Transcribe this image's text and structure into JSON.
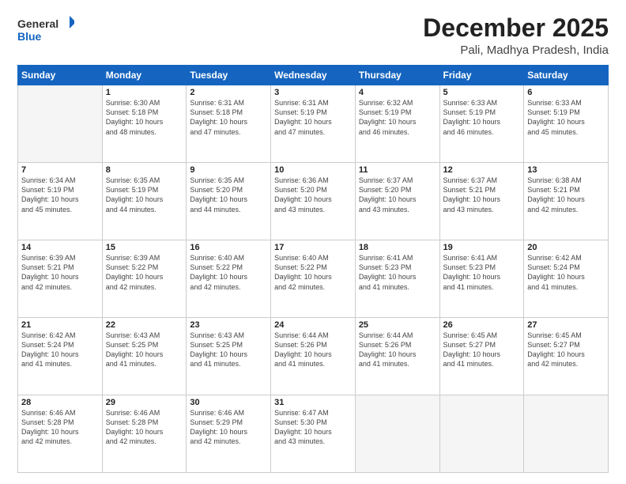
{
  "logo": {
    "line1": "General",
    "line2": "Blue"
  },
  "title": "December 2025",
  "subtitle": "Pali, Madhya Pradesh, India",
  "headers": [
    "Sunday",
    "Monday",
    "Tuesday",
    "Wednesday",
    "Thursday",
    "Friday",
    "Saturday"
  ],
  "weeks": [
    [
      {
        "day": "",
        "info": ""
      },
      {
        "day": "1",
        "info": "Sunrise: 6:30 AM\nSunset: 5:18 PM\nDaylight: 10 hours\nand 48 minutes."
      },
      {
        "day": "2",
        "info": "Sunrise: 6:31 AM\nSunset: 5:18 PM\nDaylight: 10 hours\nand 47 minutes."
      },
      {
        "day": "3",
        "info": "Sunrise: 6:31 AM\nSunset: 5:19 PM\nDaylight: 10 hours\nand 47 minutes."
      },
      {
        "day": "4",
        "info": "Sunrise: 6:32 AM\nSunset: 5:19 PM\nDaylight: 10 hours\nand 46 minutes."
      },
      {
        "day": "5",
        "info": "Sunrise: 6:33 AM\nSunset: 5:19 PM\nDaylight: 10 hours\nand 46 minutes."
      },
      {
        "day": "6",
        "info": "Sunrise: 6:33 AM\nSunset: 5:19 PM\nDaylight: 10 hours\nand 45 minutes."
      }
    ],
    [
      {
        "day": "7",
        "info": "Sunrise: 6:34 AM\nSunset: 5:19 PM\nDaylight: 10 hours\nand 45 minutes."
      },
      {
        "day": "8",
        "info": "Sunrise: 6:35 AM\nSunset: 5:19 PM\nDaylight: 10 hours\nand 44 minutes."
      },
      {
        "day": "9",
        "info": "Sunrise: 6:35 AM\nSunset: 5:20 PM\nDaylight: 10 hours\nand 44 minutes."
      },
      {
        "day": "10",
        "info": "Sunrise: 6:36 AM\nSunset: 5:20 PM\nDaylight: 10 hours\nand 43 minutes."
      },
      {
        "day": "11",
        "info": "Sunrise: 6:37 AM\nSunset: 5:20 PM\nDaylight: 10 hours\nand 43 minutes."
      },
      {
        "day": "12",
        "info": "Sunrise: 6:37 AM\nSunset: 5:21 PM\nDaylight: 10 hours\nand 43 minutes."
      },
      {
        "day": "13",
        "info": "Sunrise: 6:38 AM\nSunset: 5:21 PM\nDaylight: 10 hours\nand 42 minutes."
      }
    ],
    [
      {
        "day": "14",
        "info": "Sunrise: 6:39 AM\nSunset: 5:21 PM\nDaylight: 10 hours\nand 42 minutes."
      },
      {
        "day": "15",
        "info": "Sunrise: 6:39 AM\nSunset: 5:22 PM\nDaylight: 10 hours\nand 42 minutes."
      },
      {
        "day": "16",
        "info": "Sunrise: 6:40 AM\nSunset: 5:22 PM\nDaylight: 10 hours\nand 42 minutes."
      },
      {
        "day": "17",
        "info": "Sunrise: 6:40 AM\nSunset: 5:22 PM\nDaylight: 10 hours\nand 42 minutes."
      },
      {
        "day": "18",
        "info": "Sunrise: 6:41 AM\nSunset: 5:23 PM\nDaylight: 10 hours\nand 41 minutes."
      },
      {
        "day": "19",
        "info": "Sunrise: 6:41 AM\nSunset: 5:23 PM\nDaylight: 10 hours\nand 41 minutes."
      },
      {
        "day": "20",
        "info": "Sunrise: 6:42 AM\nSunset: 5:24 PM\nDaylight: 10 hours\nand 41 minutes."
      }
    ],
    [
      {
        "day": "21",
        "info": "Sunrise: 6:42 AM\nSunset: 5:24 PM\nDaylight: 10 hours\nand 41 minutes."
      },
      {
        "day": "22",
        "info": "Sunrise: 6:43 AM\nSunset: 5:25 PM\nDaylight: 10 hours\nand 41 minutes."
      },
      {
        "day": "23",
        "info": "Sunrise: 6:43 AM\nSunset: 5:25 PM\nDaylight: 10 hours\nand 41 minutes."
      },
      {
        "day": "24",
        "info": "Sunrise: 6:44 AM\nSunset: 5:26 PM\nDaylight: 10 hours\nand 41 minutes."
      },
      {
        "day": "25",
        "info": "Sunrise: 6:44 AM\nSunset: 5:26 PM\nDaylight: 10 hours\nand 41 minutes."
      },
      {
        "day": "26",
        "info": "Sunrise: 6:45 AM\nSunset: 5:27 PM\nDaylight: 10 hours\nand 41 minutes."
      },
      {
        "day": "27",
        "info": "Sunrise: 6:45 AM\nSunset: 5:27 PM\nDaylight: 10 hours\nand 42 minutes."
      }
    ],
    [
      {
        "day": "28",
        "info": "Sunrise: 6:46 AM\nSunset: 5:28 PM\nDaylight: 10 hours\nand 42 minutes."
      },
      {
        "day": "29",
        "info": "Sunrise: 6:46 AM\nSunset: 5:28 PM\nDaylight: 10 hours\nand 42 minutes."
      },
      {
        "day": "30",
        "info": "Sunrise: 6:46 AM\nSunset: 5:29 PM\nDaylight: 10 hours\nand 42 minutes."
      },
      {
        "day": "31",
        "info": "Sunrise: 6:47 AM\nSunset: 5:30 PM\nDaylight: 10 hours\nand 43 minutes."
      },
      {
        "day": "",
        "info": ""
      },
      {
        "day": "",
        "info": ""
      },
      {
        "day": "",
        "info": ""
      }
    ]
  ]
}
